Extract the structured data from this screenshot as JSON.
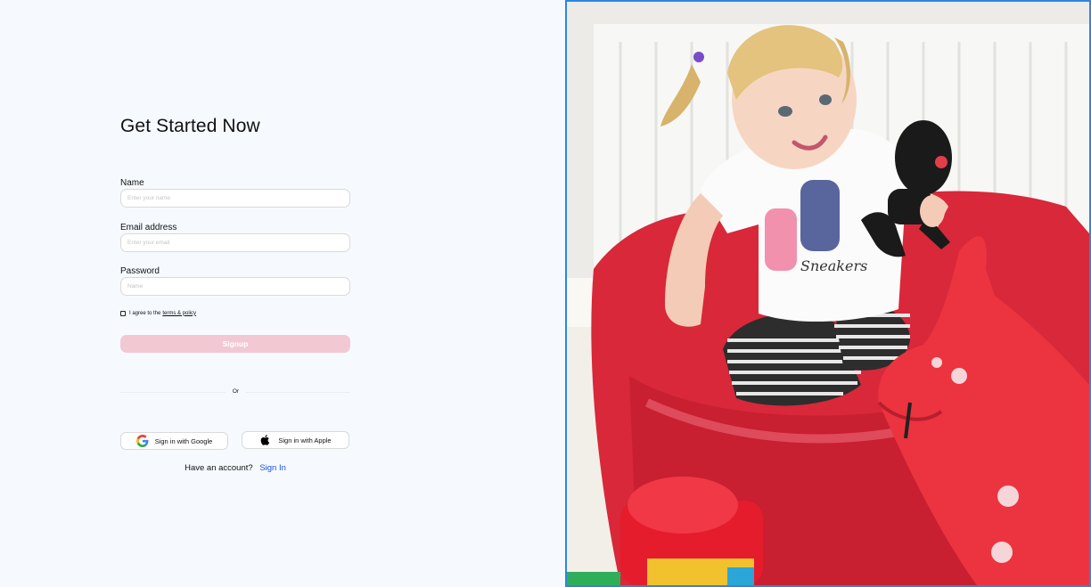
{
  "form": {
    "title": "Get Started Now",
    "name_label": "Name",
    "name_placeholder": "Enter your name",
    "email_label": "Email address",
    "email_placeholder": "Enter your email",
    "password_label": "Password",
    "password_placeholder": "Name",
    "terms_text": "I agree to the",
    "terms_link": "terms & policy",
    "signup_label": "Signup",
    "divider_text": "Or",
    "google_label": "Sign in with Google",
    "apple_label": "Sign in with Apple",
    "have_account_text": "Have an account?",
    "signin_link": "Sign In"
  },
  "photo": {
    "subject": "child-on-red-beanbag-photo",
    "shirt_text": "Sneakers"
  },
  "colors": {
    "background": "#f6faff",
    "signup_button": "#f2c9d3",
    "signin_link": "#1f4fd6",
    "photo_border": "#2b86e6",
    "beanbag": "#d8283a"
  }
}
